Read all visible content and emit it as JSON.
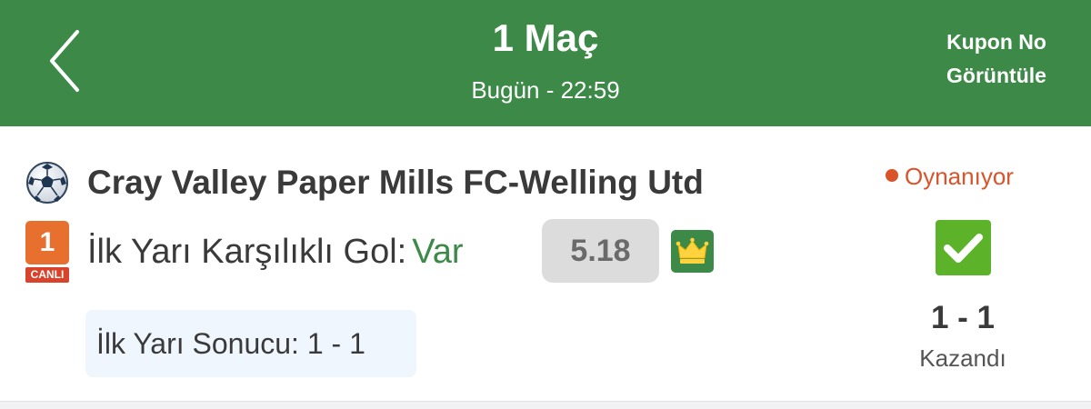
{
  "header": {
    "title": "1 Maç",
    "subtitle": "Bugün - 22:59",
    "kupon_line1": "Kupon No",
    "kupon_line2": "Görüntüle",
    "background": "#3d8a48"
  },
  "match": {
    "sport_icon": "soccer-ball-icon",
    "name": "Cray Valley Paper Mills FC-Welling Utd",
    "status": "Oynanıyor",
    "status_color": "#d9542b",
    "live_badge_number": "1",
    "live_badge_label": "CANLI",
    "bet_label": "İlk Yarı Karşılıklı Gol:",
    "bet_value": "Var",
    "odds": "5.18",
    "odds_icon": "crown-icon",
    "result_icon": "check-icon",
    "score": "1 - 1",
    "result": "Kazandı",
    "half_time": "İlk Yarı Sonucu: 1 - 1"
  }
}
